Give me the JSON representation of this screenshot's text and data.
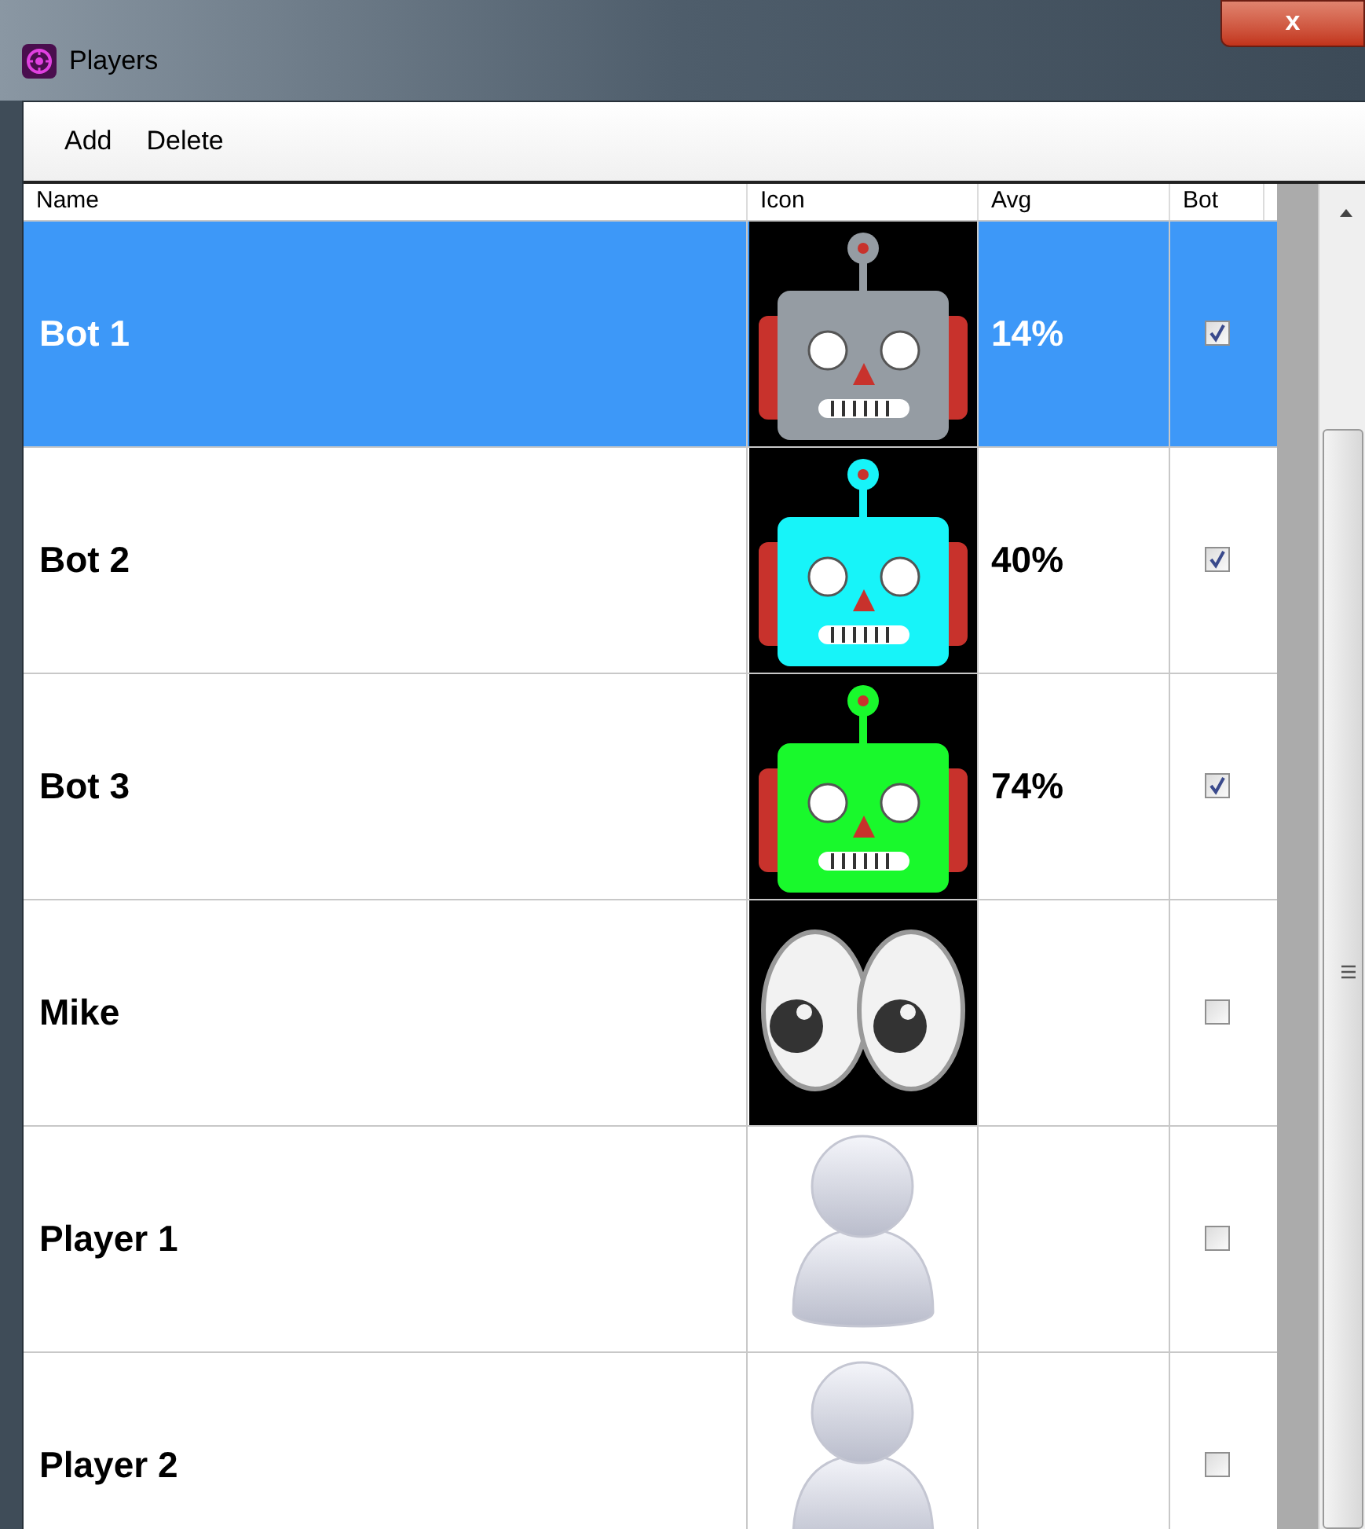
{
  "window": {
    "title": "Players",
    "close": "x"
  },
  "toolbar": [
    "Add",
    "Delete"
  ],
  "table": {
    "columns": [
      "Name",
      "Icon",
      "Avg",
      "Bot"
    ],
    "rows": [
      {
        "name": "Bot 1",
        "icon": {
          "kind": "robot",
          "color": "#959ca3"
        },
        "avg": "14%",
        "bot": true,
        "selected": true
      },
      {
        "name": "Bot 2",
        "icon": {
          "kind": "robot",
          "color": "#17f4f9"
        },
        "avg": "40%",
        "bot": true,
        "selected": false
      },
      {
        "name": "Bot 3",
        "icon": {
          "kind": "robot",
          "color": "#19f92c"
        },
        "avg": "74%",
        "bot": true,
        "selected": false
      },
      {
        "name": "Mike",
        "icon": {
          "kind": "eyes"
        },
        "bot": false,
        "selected": false
      },
      {
        "name": "Player 1",
        "icon": {
          "kind": "person"
        },
        "bot": false,
        "selected": false
      },
      {
        "name": "Player 2",
        "icon": {
          "kind": "person"
        },
        "bot": false,
        "selected": false
      }
    ]
  }
}
